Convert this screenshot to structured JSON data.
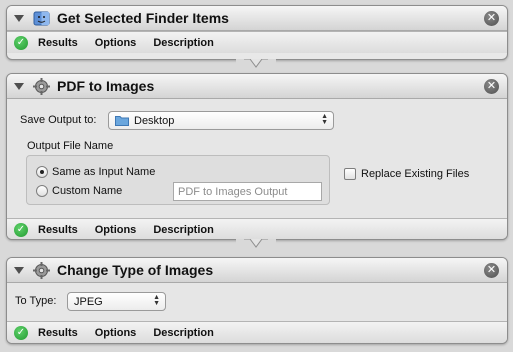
{
  "actions": [
    {
      "title": "Get Selected Finder Items",
      "footer": [
        "Results",
        "Options",
        "Description"
      ]
    },
    {
      "title": "PDF to Images",
      "save_output_label": "Save Output to:",
      "save_output_value": "Desktop",
      "output_file_name_label": "Output File Name",
      "radio_same": "Same as Input Name",
      "radio_custom": "Custom Name",
      "custom_name_placeholder": "PDF to Images Output",
      "replace_existing": "Replace Existing Files",
      "footer": [
        "Results",
        "Options",
        "Description"
      ]
    },
    {
      "title": "Change Type of Images",
      "to_type_label": "To Type:",
      "to_type_value": "JPEG",
      "footer": [
        "Results",
        "Options",
        "Description"
      ]
    }
  ],
  "icons": {
    "disclosure": "disclosure-triangle-icon",
    "action": "automator-action-icon",
    "close": "close-icon",
    "status": "checkmark-icon",
    "folder": "folder-icon"
  },
  "colors": {
    "status_green": "#229a31",
    "folder_blue": "#6aa6dd"
  }
}
